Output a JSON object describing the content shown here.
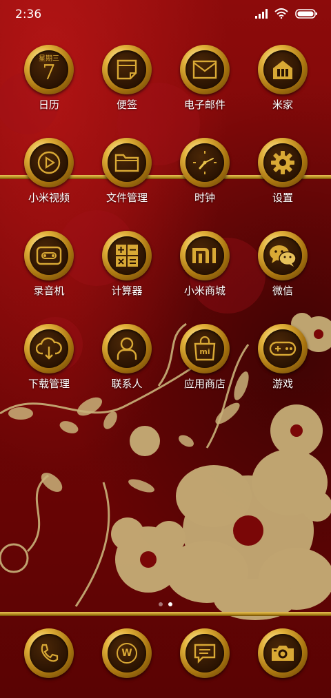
{
  "status_bar": {
    "time": "2:36"
  },
  "apps": [
    {
      "label": "日历",
      "icon": "calendar-icon",
      "weekday": "星期三",
      "day": "7"
    },
    {
      "label": "便签",
      "icon": "notes-icon"
    },
    {
      "label": "电子邮件",
      "icon": "mail-icon"
    },
    {
      "label": "米家",
      "icon": "mijia-home-icon"
    },
    {
      "label": "小米视频",
      "icon": "video-play-icon"
    },
    {
      "label": "文件管理",
      "icon": "folder-icon"
    },
    {
      "label": "时钟",
      "icon": "clock-icon"
    },
    {
      "label": "设置",
      "icon": "gear-icon"
    },
    {
      "label": "录音机",
      "icon": "cassette-icon"
    },
    {
      "label": "计算器",
      "icon": "calculator-icon"
    },
    {
      "label": "小米商城",
      "icon": "mi-store-icon",
      "mark": "MI"
    },
    {
      "label": "微信",
      "icon": "wechat-icon"
    },
    {
      "label": "下载管理",
      "icon": "cloud-download-icon"
    },
    {
      "label": "联系人",
      "icon": "contact-person-icon"
    },
    {
      "label": "应用商店",
      "icon": "shopping-bag-icon",
      "mark": "mi"
    },
    {
      "label": "游戏",
      "icon": "gamepad-icon"
    }
  ],
  "dock": [
    {
      "icon": "phone-icon"
    },
    {
      "icon": "browser-w-icon",
      "mark": "W"
    },
    {
      "icon": "message-bubble-icon"
    },
    {
      "icon": "camera-icon"
    }
  ],
  "pager": {
    "pages": 2,
    "current": 2
  },
  "colors": {
    "gold": "#d9a935",
    "dark_inner": "#2a1302",
    "background": "#7a0707"
  }
}
